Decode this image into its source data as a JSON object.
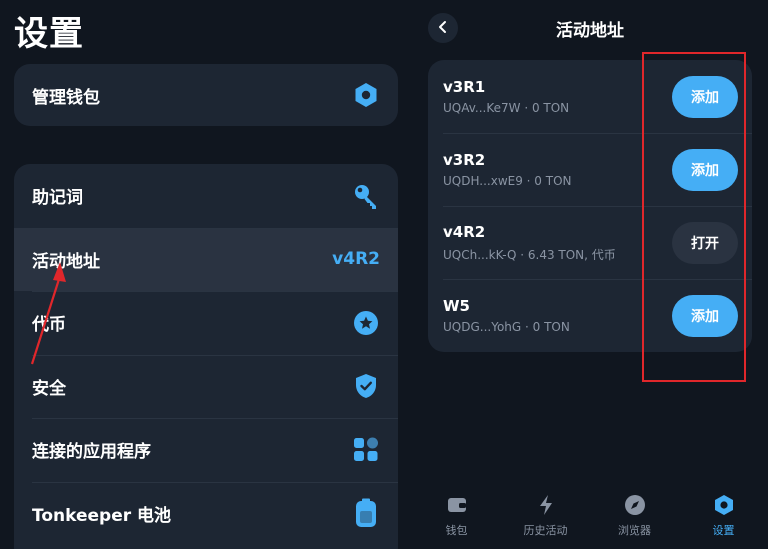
{
  "left": {
    "title": "设置",
    "manage": {
      "label": "管理钱包",
      "icon": "hexagon-icon"
    },
    "items": [
      {
        "label": "助记词",
        "icon": "key-icon",
        "value": ""
      },
      {
        "label": "活动地址",
        "icon": "",
        "value": "v4R2"
      },
      {
        "label": "代币",
        "icon": "star-circle-icon",
        "value": ""
      },
      {
        "label": "安全",
        "icon": "shield-check-icon",
        "value": ""
      },
      {
        "label": "连接的应用程序",
        "icon": "apps-grid-icon",
        "value": ""
      },
      {
        "label": "Tonkeeper 电池",
        "icon": "battery-icon",
        "value": ""
      }
    ]
  },
  "right": {
    "title": "活动地址",
    "wallets": [
      {
        "name": "v3R1",
        "sub": "UQAv...Ke7W · 0 TON",
        "action": "添加",
        "style": "add"
      },
      {
        "name": "v3R2",
        "sub": "UQDH...xwE9 · 0 TON",
        "action": "添加",
        "style": "add"
      },
      {
        "name": "v4R2",
        "sub": "UQCh...kK-Q · 6.43 TON, 代币",
        "action": "打开",
        "style": "open"
      },
      {
        "name": "W5",
        "sub": "UQDG...YohG · 0 TON",
        "action": "添加",
        "style": "add"
      }
    ],
    "tabs": [
      {
        "label": "钱包",
        "icon": "wallet-icon",
        "active": false
      },
      {
        "label": "历史活动",
        "icon": "lightning-icon",
        "active": false
      },
      {
        "label": "浏览器",
        "icon": "compass-icon",
        "active": false
      },
      {
        "label": "设置",
        "icon": "settings-hexagon-icon",
        "active": true
      }
    ]
  },
  "colors": {
    "background": "#10161f",
    "card": "#1d2633",
    "accent": "#45aef5",
    "highlight_border": "#e0272b"
  }
}
